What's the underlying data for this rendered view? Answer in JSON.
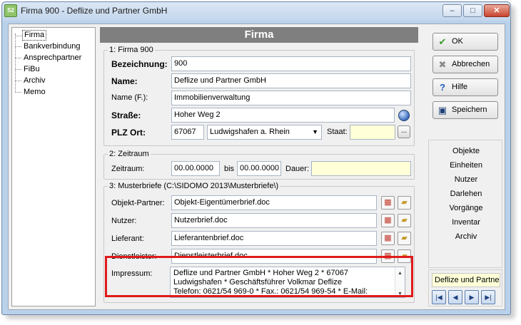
{
  "window": {
    "title": "Firma 900 - Deflize und Partner GmbH",
    "app_icon_text": "S2",
    "minimize": "–",
    "maximize": "□",
    "close": "✕"
  },
  "tree": {
    "items": [
      "Firma",
      "Bankverbindung",
      "Ansprechpartner",
      "FiBu",
      "Archiv",
      "Memo"
    ],
    "selected": "Firma"
  },
  "main": {
    "header": "Firma",
    "group1": {
      "title": "1: Firma 900",
      "bezeichnung_label": "Bezeichnung:",
      "bezeichnung": "900",
      "name_label": "Name:",
      "name": "Deflize und Partner GmbH",
      "name_f_label": "Name (F.):",
      "name_f": "Immobilienverwaltung",
      "strasse_label": "Straße:",
      "strasse": "Hoher Weg 2",
      "plz_label": "PLZ Ort:",
      "plz": "67067",
      "ort": "Ludwigshafen a. Rhein",
      "staat_label": "Staat:",
      "staat": "",
      "ellipsis": "..."
    },
    "group2": {
      "title": "2: Zeitraum",
      "zeitraum_label": "Zeitraum:",
      "von": "00.00.0000",
      "bis_label": "bis",
      "bis": "00.00.0000",
      "dauer_label": "Dauer:",
      "dauer": ""
    },
    "group3": {
      "title": "3: Musterbriefe (C:\\SIDOMO 2013\\Musterbriefe\\)",
      "rows": [
        {
          "label": "Objekt-Partner:",
          "value": "Objekt-Eigentümerbrief.doc"
        },
        {
          "label": "Nutzer:",
          "value": "Nutzerbrief.doc"
        },
        {
          "label": "Lieferant:",
          "value": "Lieferantenbrief.doc"
        },
        {
          "label": "Dienstleister:",
          "value": "Dienstleisterbrief.doc"
        }
      ],
      "impressum_label": "Impressum:",
      "impressum_lines": [
        "Deflize und Partner GmbH * Hoher Weg 2 * 67067",
        "Ludwigshafen * Geschäftsführer Volkmar Deflize",
        "Telefon: 0621/54 969-0 * Fax.: 0621/54 969-54 * E-Mail:"
      ]
    }
  },
  "buttons": {
    "ok": "OK",
    "abbrechen": "Abbrechen",
    "hilfe": "Hilfe",
    "speichern": "Speichern"
  },
  "nav": {
    "items": [
      "Objekte",
      "Einheiten",
      "Nutzer",
      "Darlehen",
      "Vorgänge",
      "Inventar",
      "Archiv"
    ],
    "current": "Deflize und Partne",
    "first": "|◀",
    "prev": "◀",
    "next": "▶",
    "last": "▶|"
  },
  "colors": {
    "highlight": "#e01a1a",
    "header_bg": "#7f7f7f",
    "yellow_field": "#ffffd8"
  }
}
